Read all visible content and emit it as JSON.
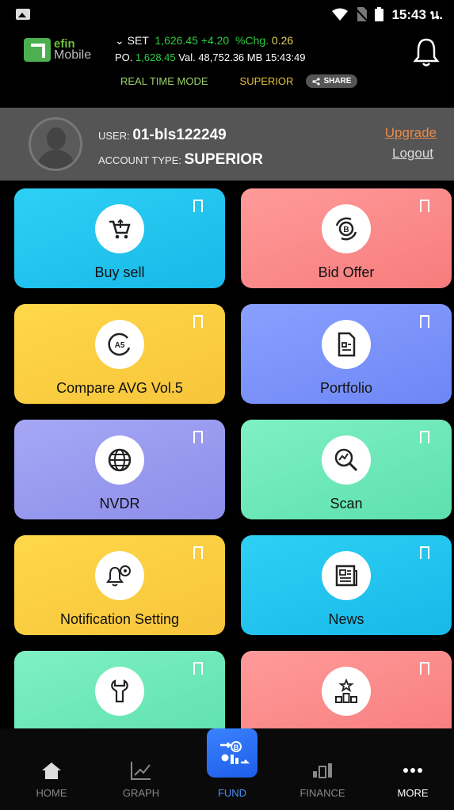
{
  "status_bar": {
    "time": "15:43 น."
  },
  "header": {
    "logo_top": "efin",
    "logo_bottom": "Mobile",
    "market_index_label": "SET",
    "market_index_value": "1,626.45",
    "market_change": "+4.20",
    "pct_label": "%Chg.",
    "pct_value": "0.26",
    "po_label": "PO.",
    "po_value": "1,628.45",
    "val_label": "Val.",
    "val_value": "48,752.36 MB",
    "val_time": "15:43:49",
    "mode_realtime": "REAL TIME MODE",
    "mode_account": "SUPERIOR",
    "share_label": "SHARE"
  },
  "user": {
    "user_label": "USER:",
    "user_id": "01-bls122249",
    "account_label": "ACCOUNT TYPE:",
    "account_type": "SUPERIOR",
    "upgrade": "Upgrade",
    "logout": "Logout"
  },
  "tiles": [
    {
      "label": "Buy sell",
      "icon": "cart-exchange-icon",
      "color": "#22c4ef"
    },
    {
      "label": "Bid Offer",
      "icon": "bid-offer-icon",
      "color": "#fa8a8a"
    },
    {
      "label": "Compare AVG Vol.5",
      "icon": "a5-icon",
      "color": "#fbce42"
    },
    {
      "label": "Portfolio",
      "icon": "portfolio-doc-icon",
      "color": "#7a92fa"
    },
    {
      "label": "NVDR",
      "icon": "globe-icon",
      "color": "#989aef"
    },
    {
      "label": "Scan",
      "icon": "scan-chart-icon",
      "color": "#6ee8b8"
    },
    {
      "label": "Notification Setting",
      "icon": "bell-gear-icon",
      "color": "#fbce42"
    },
    {
      "label": "News",
      "icon": "newspaper-icon",
      "color": "#22c4ef"
    },
    {
      "label": "",
      "icon": "wrench-icon",
      "color": "#6ee8b8"
    },
    {
      "label": "",
      "icon": "ranking-icon",
      "color": "#fa8a8a"
    }
  ],
  "nav": {
    "home": "HOME",
    "graph": "GRAPH",
    "fund": "FUND",
    "finance": "FINANCE",
    "more": "MORE"
  }
}
